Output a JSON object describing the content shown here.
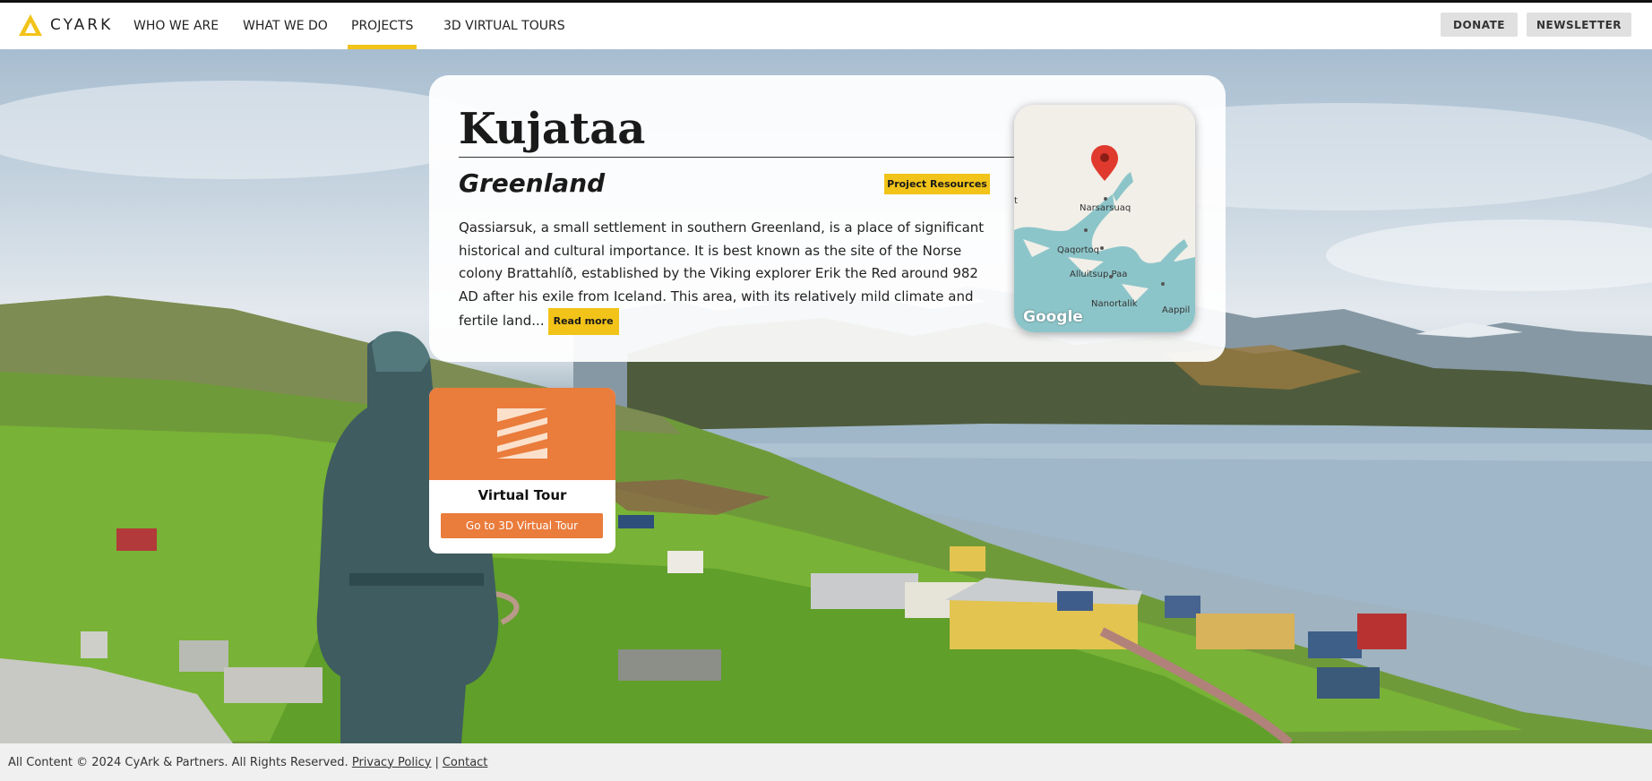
{
  "nav": {
    "logo_text": "CYARK",
    "items": [
      {
        "label": "WHO WE ARE"
      },
      {
        "label": "WHAT WE DO"
      },
      {
        "label": "PROJECTS",
        "active": true
      },
      {
        "label": "3D VIRTUAL TOURS"
      }
    ],
    "donate_label": "DONATE",
    "newsletter_label": "NEWSLETTER",
    "accent_color": "#f2c318"
  },
  "project": {
    "title": "Kujataa",
    "subtitle": "Greenland",
    "resources_label": "Project Resources",
    "description": "Qassiarsuk, a small settlement in southern Greenland, is a place of significant historical and cultural importance. It is best known as the site of the Norse colony Brattahlíð, established by the Viking explorer Erik the Red around 982 AD after his exile from Iceland. This area, with its relatively mild climate and fertile land...",
    "read_more_label": "Read more"
  },
  "map": {
    "labels": {
      "narsarsuaq": "Narsarsuaq",
      "qaqortoq": "Qaqortoq",
      "alluitsup": "Alluitsup Paa",
      "nanortalik": "Nanortalik",
      "aappilattoq": "Aappil",
      "edge": "t"
    },
    "provider": "Google",
    "pin_color": "#e03a2e",
    "water_color": "#8cc5c9"
  },
  "tour": {
    "title": "Virtual Tour",
    "button_label": "Go to 3D Virtual Tour",
    "accent_color": "#ea7c3c"
  },
  "footer": {
    "copyright": "All Content © 2024 CyArk & Partners. All Rights Reserved.",
    "privacy_label": "Privacy Policy",
    "separator": "|",
    "contact_label": "Contact"
  }
}
